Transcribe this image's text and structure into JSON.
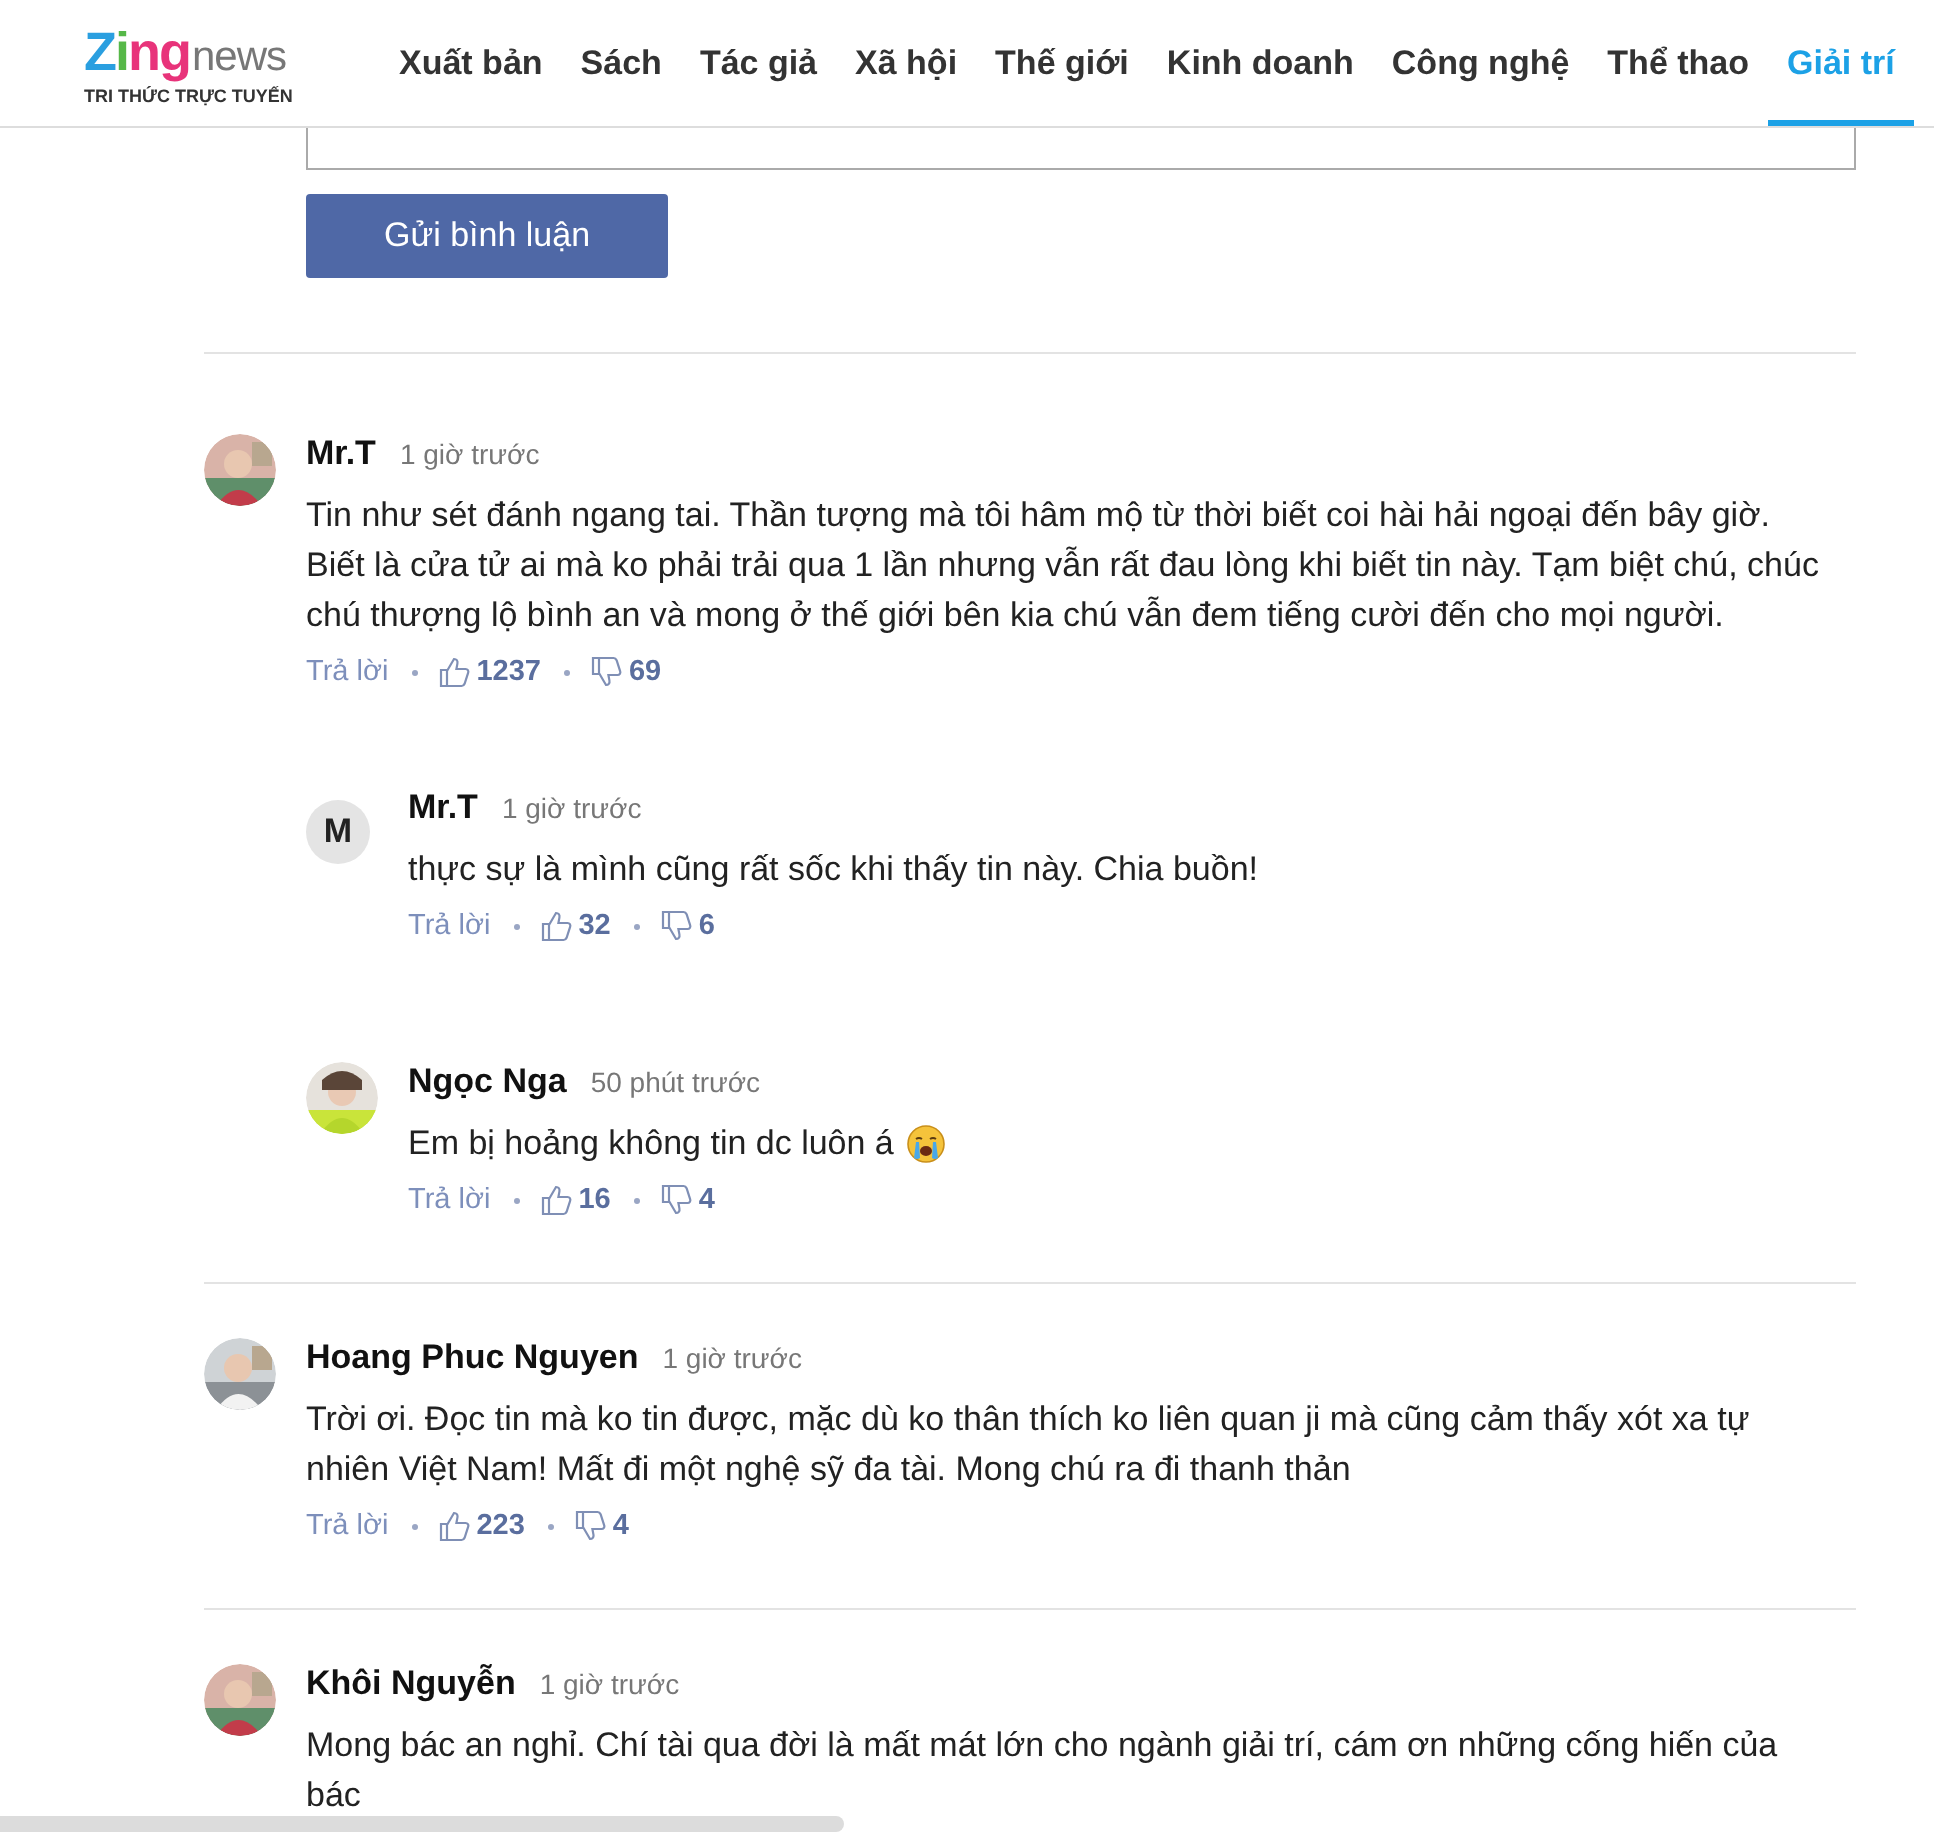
{
  "header": {
    "logo": {
      "brand": "Zing",
      "suffix": "news",
      "tagline": "TRI THỨC TRỰC TUYẾN"
    },
    "nav": [
      {
        "label": "Xuất bản",
        "selected": false
      },
      {
        "label": "Sách",
        "selected": false
      },
      {
        "label": "Tác giả",
        "selected": false
      },
      {
        "label": "Xã hội",
        "selected": false
      },
      {
        "label": "Thế giới",
        "selected": false
      },
      {
        "label": "Kinh doanh",
        "selected": false
      },
      {
        "label": "Công nghệ",
        "selected": false
      },
      {
        "label": "Thể thao",
        "selected": false
      },
      {
        "label": "Giải trí",
        "selected": true
      }
    ]
  },
  "comment_form": {
    "submit_button": "Gửi bình luận"
  },
  "comments": [
    {
      "author": "Mr.T",
      "time": "1 giờ trước",
      "avatar": {
        "kind": "picture"
      },
      "text": "Tin như sét đánh ngang tai. Thần tượng mà tôi hâm mộ từ thời biết coi hài hải ngoại đến bây giờ. Biết là cửa tử ai mà ko phải trải qua 1 lần nhưng vẫn rất đau lòng khi biết tin này. Tạm biệt chú, chúc chú thượng lộ bình an và mong ở thế giới bên kia chú vẫn đem tiếng cười đến cho mọi người.",
      "reply": "Trả lời",
      "likes": "1237",
      "dislikes": "69",
      "replies": [
        {
          "author": "Mr.T",
          "time": "1 giờ trước",
          "avatar": {
            "kind": "initial",
            "letter": "M"
          },
          "text": "thực sự là mình cũng rất sốc khi thấy tin này. Chia buồn!",
          "reply": "Trả lời",
          "likes": "32",
          "dislikes": "6"
        },
        {
          "author": "Ngọc Nga",
          "time": "50 phút trước",
          "avatar": {
            "kind": "picture"
          },
          "text": "Em bị hoảng không tin dc luôn á",
          "emoji": {
            "kind": "crying"
          },
          "reply": "Trả lời",
          "likes": "16",
          "dislikes": "4"
        }
      ]
    },
    {
      "author": "Hoang Phuc Nguyen",
      "time": "1 giờ trước",
      "avatar": {
        "kind": "picture"
      },
      "text": "Trời ơi. Đọc tin mà ko tin được, mặc dù ko thân thích ko liên quan ji mà cũng cảm thấy xót xa tự nhiên Việt Nam! Mất đi một nghệ sỹ đa tài. Mong chú ra đi thanh thản",
      "reply": "Trả lời",
      "likes": "223",
      "dislikes": "4"
    },
    {
      "author": "Khôi Nguyễn",
      "time": "1 giờ trước",
      "avatar": {
        "kind": "picture"
      },
      "text": "Mong bác an nghỉ. Chí tài qua đời là mất mát lớn cho ngành giải trí, cám ơn những cống hiến của bác"
    }
  ]
}
